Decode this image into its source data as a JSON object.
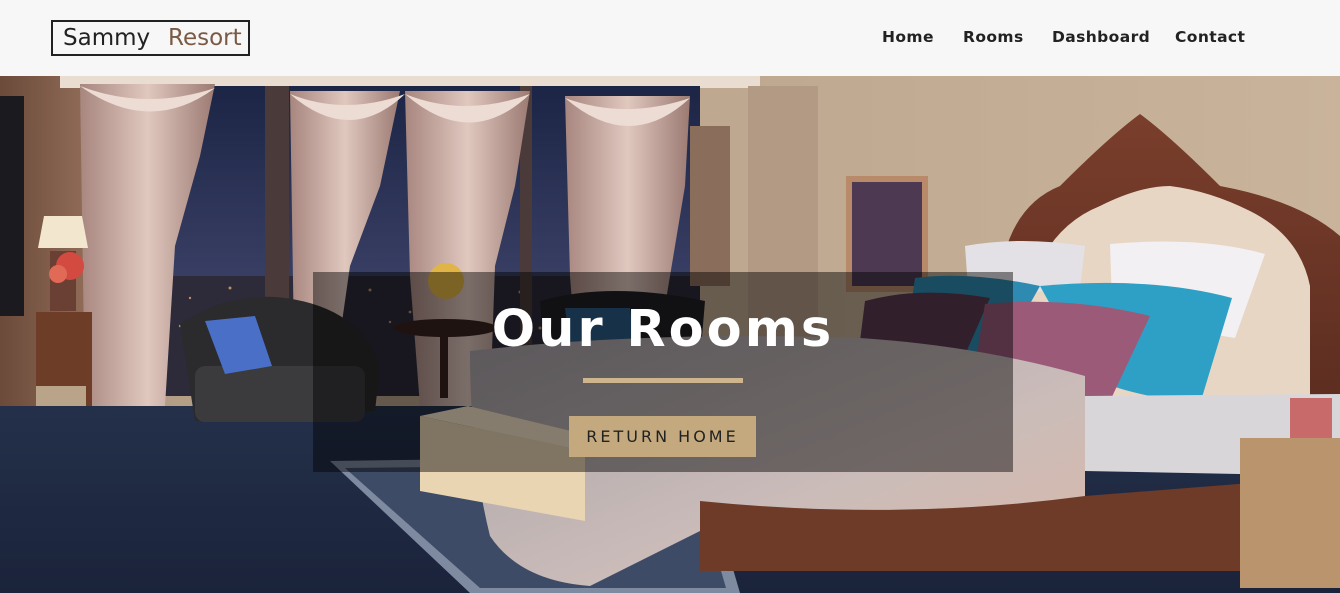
{
  "brand": {
    "word1": "Sammy",
    "word2": "Resort",
    "color_dark": "#222222",
    "color_accent": "#7a5a44"
  },
  "nav": {
    "items": [
      {
        "label": "Home"
      },
      {
        "label": "Rooms"
      },
      {
        "label": "Dashboard"
      },
      {
        "label": "Contact"
      }
    ]
  },
  "hero": {
    "background_image": "hotel-bedroom-illustration",
    "banner": {
      "title": "Our Rooms",
      "button_label": "RETURN HOME",
      "accent_color": "#c4a97f"
    }
  }
}
